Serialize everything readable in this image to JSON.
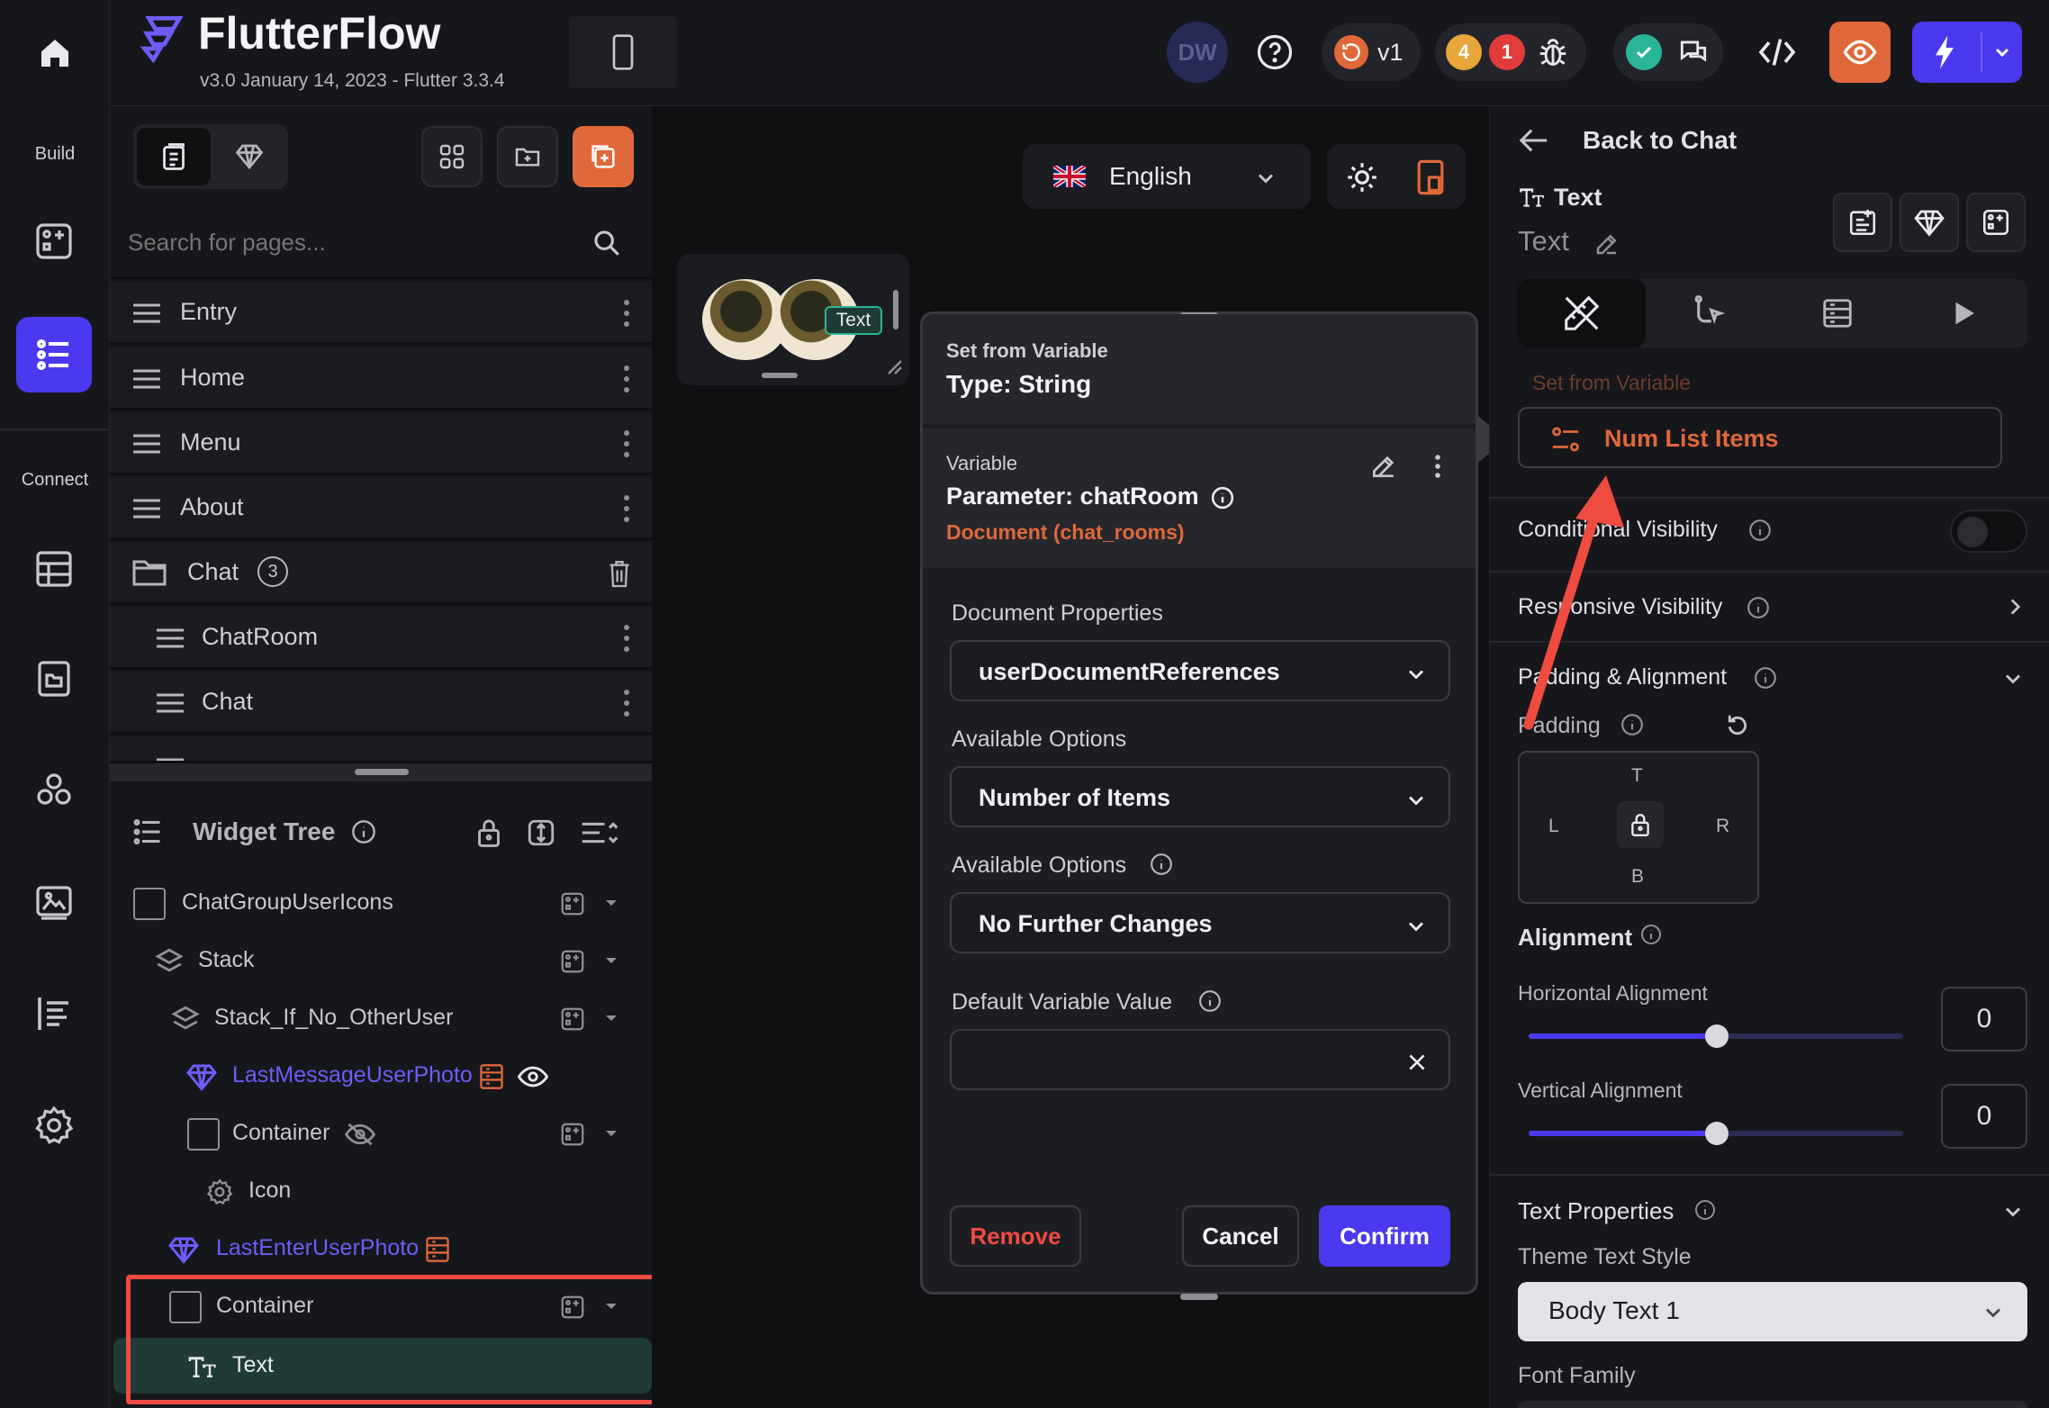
{
  "app": {
    "name": "FlutterFlow",
    "version": "v3.0 January 14, 2023 - Flutter 3.3.4"
  },
  "rail": {
    "build_label": "Build",
    "connect_label": "Connect"
  },
  "header": {
    "avatar_initials": "DW",
    "version_badge": "v1",
    "warning_count": "4",
    "error_count": "1"
  },
  "pages_panel": {
    "search_placeholder": "Search for pages...",
    "pages": [
      {
        "label": "Entry"
      },
      {
        "label": "Home"
      },
      {
        "label": "Menu"
      },
      {
        "label": "About"
      }
    ],
    "folder": {
      "label": "Chat",
      "count": "3"
    },
    "sub_pages": [
      {
        "label": "ChatRoom"
      },
      {
        "label": "Chat"
      }
    ]
  },
  "widget_tree": {
    "title": "Widget Tree",
    "items": [
      {
        "label": "ChatGroupUserIcons"
      },
      {
        "label": "Stack"
      },
      {
        "label": "Stack_If_No_OtherUser"
      },
      {
        "label": "LastMessageUserPhoto"
      },
      {
        "label": "Container"
      },
      {
        "label": "Icon"
      },
      {
        "label": "LastEnterUserPhoto"
      },
      {
        "label": "Container"
      },
      {
        "label": "Text"
      }
    ]
  },
  "canvas": {
    "language": "English",
    "preview_text_badge": "Text"
  },
  "dialog": {
    "header_label": "Set from Variable",
    "type_label": "Type: String",
    "variable_label": "Variable",
    "parameter": "Parameter: chatRoom",
    "document": "Document (chat_rooms)",
    "doc_props_label": "Document Properties",
    "doc_props_value": "userDocumentReferences",
    "options1_label": "Available Options",
    "options1_value": "Number of Items",
    "options2_label": "Available Options",
    "options2_value": "No Further Changes",
    "default_label": "Default Variable Value",
    "default_value": "",
    "remove": "Remove",
    "cancel": "Cancel",
    "confirm": "Confirm"
  },
  "props": {
    "back_label": "Back to Chat",
    "widget_type": "Text",
    "widget_name": "Text",
    "set_from_variable": "Set from Variable",
    "num_list_items": "Num List Items",
    "conditional_visibility": "Conditional Visibility",
    "responsive_visibility": "Responsive Visibility",
    "padding_alignment": "Padding & Alignment",
    "padding": "Padding",
    "pad_t": "T",
    "pad_l": "L",
    "pad_r": "R",
    "pad_b": "B",
    "alignment": "Alignment",
    "horizontal_alignment": "Horizontal Alignment",
    "horizontal_value": "0",
    "vertical_alignment": "Vertical Alignment",
    "vertical_value": "0",
    "text_properties": "Text Properties",
    "theme_text_style": "Theme Text Style",
    "theme_text_style_value": "Body Text 1",
    "font_family": "Font Family"
  },
  "colors": {
    "accent": "#4b39ef",
    "orange": "#e0683a",
    "highlight": "#ef4b41",
    "selected_row": "#1f3b35"
  }
}
